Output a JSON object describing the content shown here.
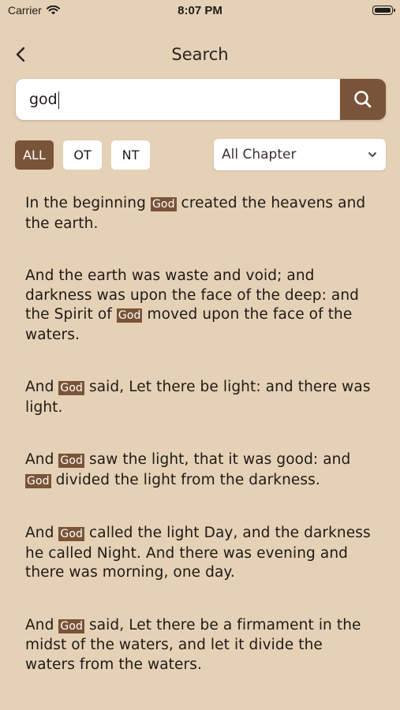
{
  "status_bar": {
    "carrier": "Carrier",
    "time": "8:07 PM"
  },
  "nav": {
    "title": "Search",
    "back_icon": "chevron-left-icon"
  },
  "search": {
    "value": "god",
    "button_icon": "magnifier-icon"
  },
  "filters": {
    "all": "ALL",
    "ot": "OT",
    "nt": "NT",
    "selected": "ALL"
  },
  "chapter_select": {
    "value": "All Chapter"
  },
  "highlight_word": "God",
  "results": [
    {
      "before": "In the beginning ",
      "after": " created the heavens and the earth."
    },
    {
      "before": "And the earth was waste and void; and darkness was upon the face of the deep: and the Spirit of ",
      "after": " moved upon the face of the waters."
    },
    {
      "before": "And ",
      "after": " said, Let there be light: and there was light."
    },
    {
      "before": "And ",
      "mid": " saw the light, that it was good: and ",
      "after": " divided the light from the darkness."
    },
    {
      "before": "And ",
      "after": " called the light Day, and the darkness he called Night. And there was evening and there was morning, one day."
    },
    {
      "before": "And ",
      "after": " said, Let there be a firmament in the midst of the waters, and let it divide the waters from the waters."
    }
  ],
  "colors": {
    "background": "#e5d1b6",
    "accent": "#7a5438"
  }
}
